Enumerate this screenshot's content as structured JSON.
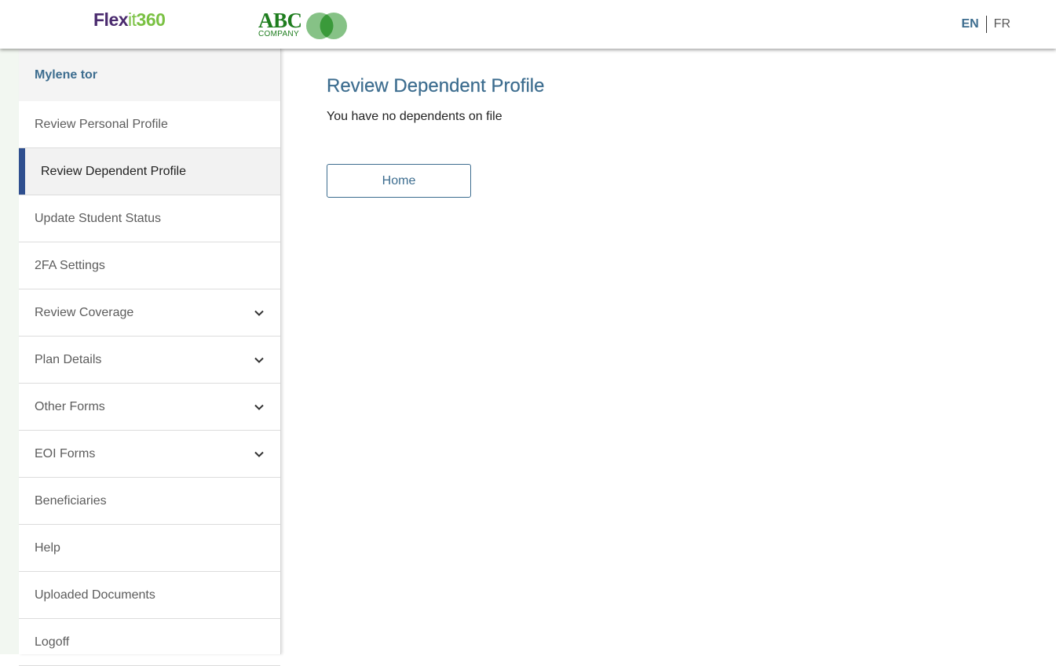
{
  "header": {
    "brand": {
      "part1": "Flex",
      "part2": "it",
      "part3": "360"
    },
    "company": {
      "abc": "ABC",
      "company": "COMPANY"
    },
    "lang": {
      "en": "EN",
      "fr": "FR"
    }
  },
  "sidebar": {
    "user_name": "Mylene tor",
    "items": [
      {
        "label": "Review Personal Profile"
      },
      {
        "label": "Review Dependent Profile"
      },
      {
        "label": "Update Student Status"
      },
      {
        "label": "2FA Settings"
      },
      {
        "label": "Review Coverage"
      },
      {
        "label": "Plan Details"
      },
      {
        "label": "Other Forms"
      },
      {
        "label": "EOI Forms"
      },
      {
        "label": "Beneficiaries"
      },
      {
        "label": "Help"
      },
      {
        "label": "Uploaded Documents"
      },
      {
        "label": "Logoff"
      }
    ]
  },
  "main": {
    "title": "Review Dependent Profile",
    "message": "You have no dependents on file",
    "home_label": "Home"
  },
  "colors": {
    "accent": "#3d6d8f",
    "active_bar": "#2f4f8f",
    "brand_purple": "#4a2a6e",
    "brand_green": "#7ac143",
    "company_green": "#1e7d1e"
  }
}
